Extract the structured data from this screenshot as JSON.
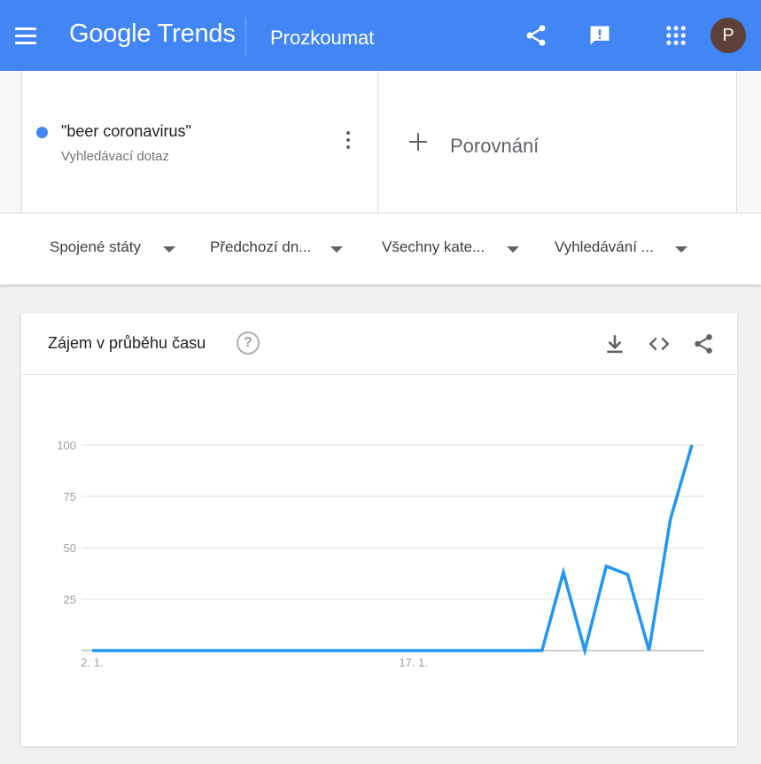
{
  "header": {
    "logo_google": "Google",
    "logo_trends": "Trends",
    "title": "Prozkoumat",
    "avatar_letter": "P",
    "icons": [
      "menu-icon",
      "share-icon",
      "feedback-icon",
      "apps-icon"
    ]
  },
  "query": {
    "term": "\"beer coronavirus\"",
    "subtitle": "Vyhledávací dotaz",
    "color": "#4285f4",
    "compare_label": "Porovnání"
  },
  "filters": [
    {
      "label": "Spojené státy"
    },
    {
      "label": "Předchozí dn..."
    },
    {
      "label": "Všechny kate..."
    },
    {
      "label": "Vyhledávání ..."
    }
  ],
  "card": {
    "title": "Zájem v průběhu času",
    "help": "?",
    "icons": [
      "download-icon",
      "embed-icon",
      "share-icon"
    ]
  },
  "colors": {
    "header": "#4285f4",
    "series": "#2196f3"
  },
  "chart_data": {
    "type": "line",
    "series": [
      {
        "values": [
          0,
          0,
          0,
          0,
          0,
          0,
          0,
          0,
          0,
          0,
          0,
          0,
          0,
          0,
          0,
          0,
          0,
          0,
          0,
          0,
          0,
          0,
          38,
          0,
          41,
          37,
          0,
          64,
          100
        ]
      }
    ],
    "x_tick_labels": [
      {
        "label": "2. 1.",
        "index": 0
      },
      {
        "label": "17. 1.",
        "index": 15
      }
    ],
    "y_ticks": [
      25,
      50,
      75,
      100
    ],
    "ylim": [
      0,
      100
    ],
    "grid": true
  }
}
